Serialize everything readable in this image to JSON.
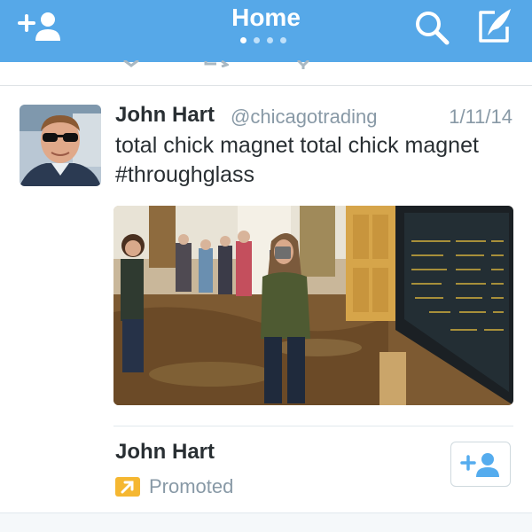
{
  "header": {
    "title": "Home",
    "page_dots": 4,
    "active_dot": 0,
    "background_color": "#56a8e8",
    "left_icon": "add-user-icon",
    "right_icons": [
      "search-icon",
      "compose-icon"
    ]
  },
  "tweet": {
    "name": "John Hart",
    "handle": "@chicagotrading",
    "date": "1/11/14",
    "text_line1": "total chick magnet total chick magnet",
    "text_line2": "#throughglass",
    "avatar_icon": "avatar",
    "media_icon": "photo"
  },
  "card": {
    "name": "John Hart",
    "promoted_label": "Promoted",
    "promoted_icon": "promoted-arrow-icon",
    "promoted_color": "#f5b731",
    "follow_icon": "add-user-icon"
  },
  "colors": {
    "text": "#292f33",
    "secondary_text": "#8899a6",
    "accent": "#55acee"
  }
}
